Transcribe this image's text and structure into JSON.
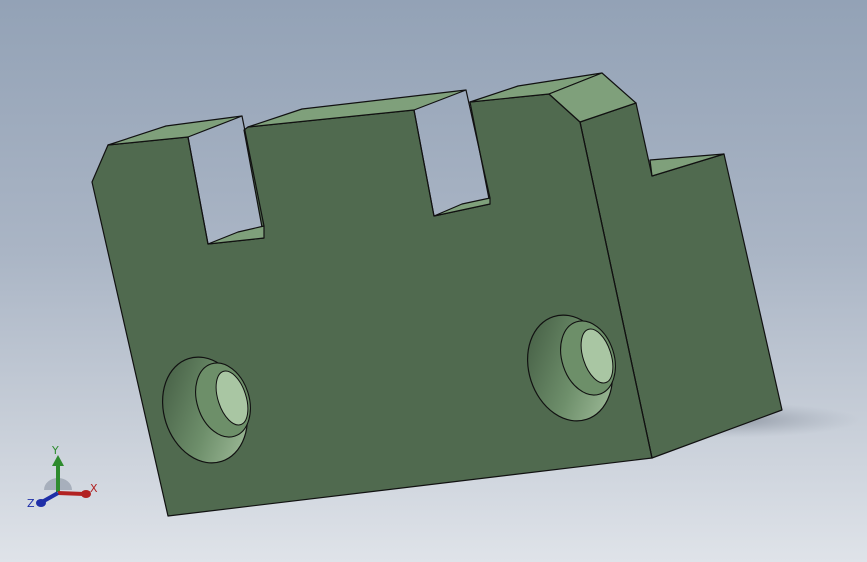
{
  "viewport": {
    "background_top": "#93a2b6",
    "background_bottom": "#dfe3e9"
  },
  "model": {
    "face_front_color": "#506a4f",
    "face_side_color": "#506a4f",
    "face_top_color": "#7fa07b",
    "edge_color": "#111111"
  },
  "triad": {
    "x_label": "X",
    "y_label": "Y",
    "z_label": "Z",
    "x_color": "#b22222",
    "y_color": "#2e8b2e",
    "z_color": "#1f2fa8"
  }
}
